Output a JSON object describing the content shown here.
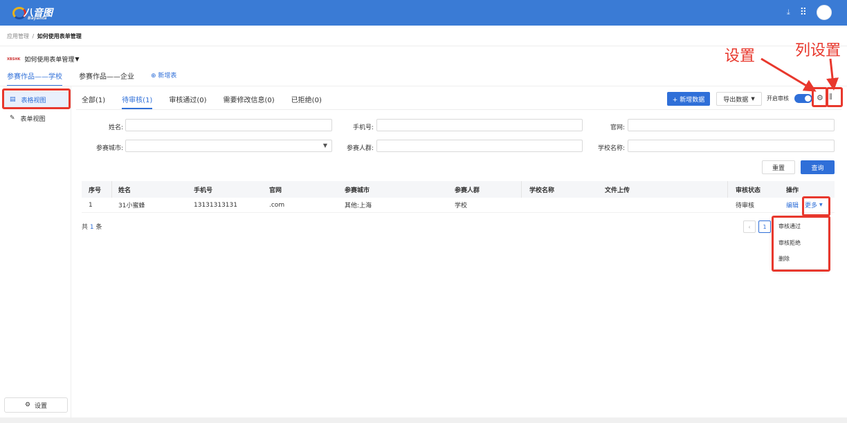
{
  "topbar": {
    "logo_text": "八音图",
    "logo_sub": "Bayanta",
    "icons": [
      "download-icon",
      "apps-grid-icon",
      "user-avatar"
    ]
  },
  "breadcrumb": {
    "parent": "应用管理",
    "separator": "/",
    "current": "如何使用表单管理"
  },
  "app": {
    "badge": "XBSHK",
    "name": "如何使用表单管理"
  },
  "app_tabs": {
    "items": [
      "参赛作品——学校",
      "参赛作品——企业"
    ],
    "add_label": "新增表"
  },
  "sidebar": {
    "items": [
      "表格视图",
      "表单视图"
    ],
    "settings_label": "设置"
  },
  "status_tabs": [
    "全部(1)",
    "待审核(1)",
    "审核通过(0)",
    "需要修改信息(0)",
    "已拒绝(0)"
  ],
  "toolbar": {
    "add_data": "+ 新增数据",
    "export": "导出数据",
    "review_toggle": "开启审核"
  },
  "filters": {
    "name": "姓名:",
    "phone": "手机号:",
    "website": "官网:",
    "city": "参赛城市:",
    "crowd": "参赛人群:",
    "school": "学校名称:",
    "reset": "重置",
    "query": "查询"
  },
  "table": {
    "headers": [
      "序号",
      "姓名",
      "手机号",
      "官网",
      "参赛城市",
      "参赛人群",
      "学校名称",
      "文件上传",
      "审核状态",
      "操作"
    ],
    "rows": [
      {
        "index": "1",
        "name": "31小蜜蜂",
        "phone": "13131313131",
        "website": ".com",
        "city": "其他:上海",
        "crowd": "学校",
        "school": "",
        "file": "",
        "status": "待审核",
        "edit": "编辑",
        "more": "更多"
      }
    ]
  },
  "footer": {
    "total_prefix": "共",
    "total_count": "1",
    "total_suffix": "条",
    "page": "1"
  },
  "more_menu": [
    "审核通过",
    "审核拒绝",
    "删除"
  ],
  "annotations": {
    "settings": "设置",
    "column_settings": "列设置"
  },
  "colors": {
    "topbar": "#3a7bd5",
    "accent": "#2f6fd8",
    "annotation": "#e8382d"
  }
}
